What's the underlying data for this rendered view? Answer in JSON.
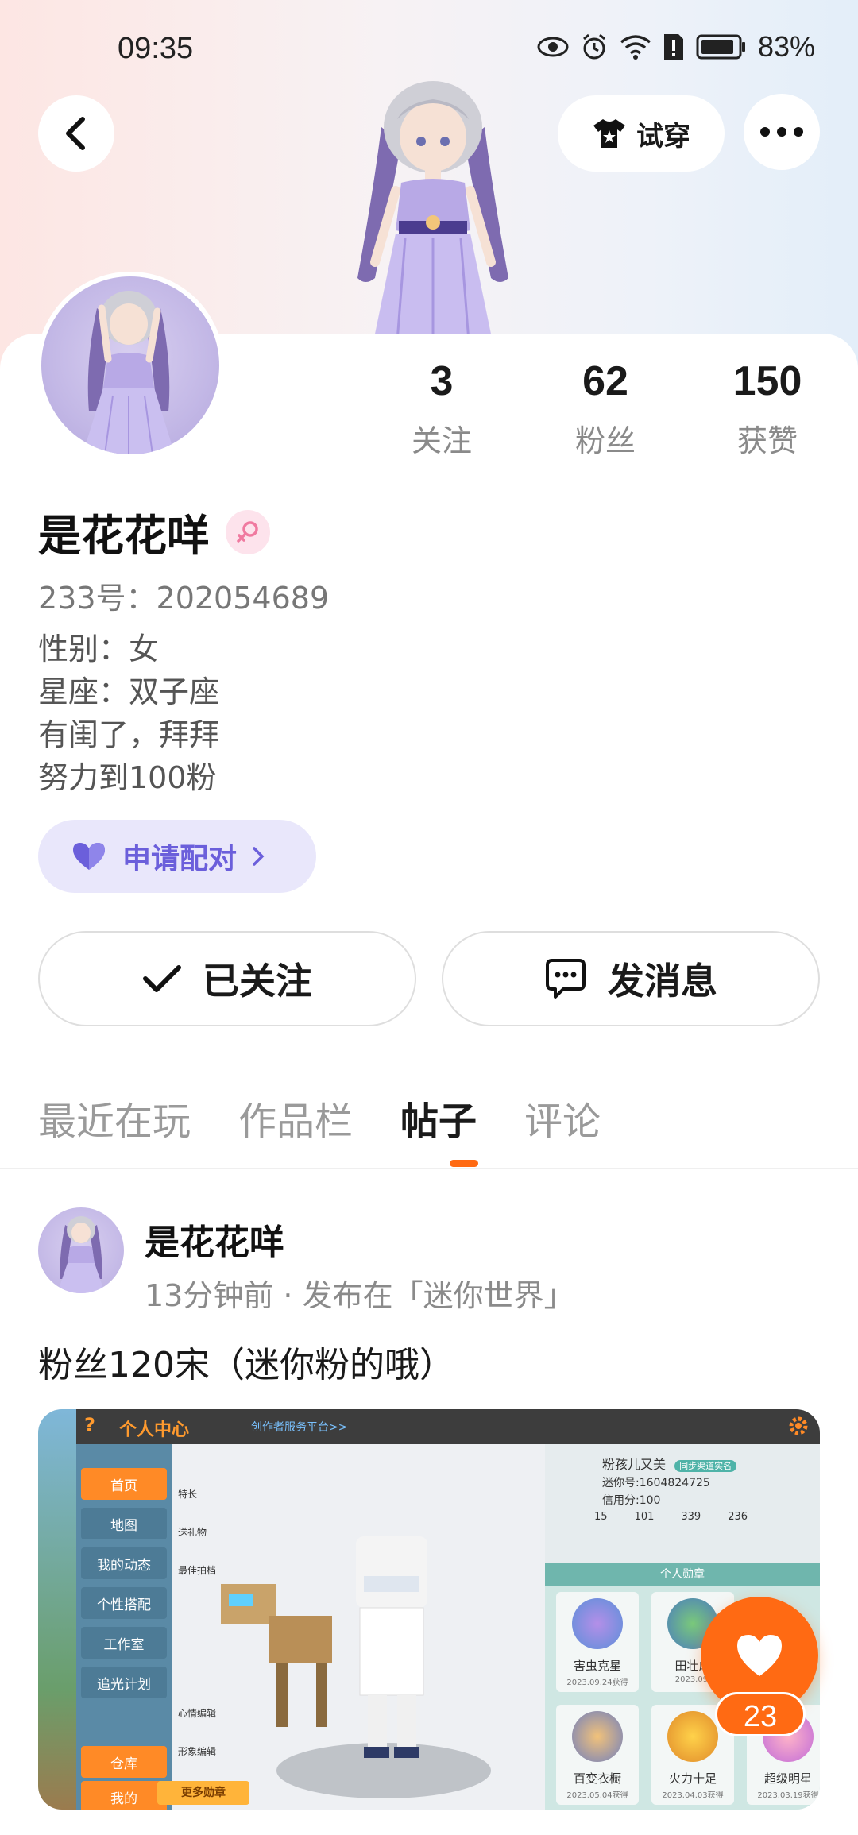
{
  "status_bar": {
    "time": "09:35",
    "battery": "83%"
  },
  "top_bar": {
    "try_on_label": "试穿"
  },
  "profile": {
    "stats": [
      {
        "value": "3",
        "label": "关注"
      },
      {
        "value": "62",
        "label": "粉丝"
      },
      {
        "value": "150",
        "label": "获赞"
      }
    ],
    "username": "是花花咩",
    "uid": "233号：202054689",
    "bio_lines": [
      "性别：女",
      "星座：双子座",
      "有闺了，拜拜",
      "努力到100粉"
    ],
    "pair_label": "申请配对",
    "followed_label": "已关注",
    "message_label": "发消息"
  },
  "tabs": [
    {
      "label": "最近在玩"
    },
    {
      "label": "作品栏"
    },
    {
      "label": "帖子",
      "active": true
    },
    {
      "label": "评论"
    }
  ],
  "post": {
    "author": "是花花咩",
    "meta": "13分钟前 · 发布在「迷你世界」",
    "text": "粉丝120宋（迷你粉的哦）",
    "image": {
      "title": "个人中心",
      "subtitle": "创作者服务平台>>",
      "menu": [
        "首页",
        "地图",
        "我的动态",
        "个性搭配",
        "工作室",
        "追光计划",
        "仓库",
        "我的"
      ],
      "side_labels": [
        "特长",
        "送礼物",
        "最佳拍档",
        "心情编辑",
        "形象编辑"
      ],
      "player_name": "粉孩儿又美",
      "player_tag": "同步渠道实名",
      "player_id": "迷你号:1604824725",
      "player_credit": "信用分:100",
      "player_stats": [
        "15",
        "101",
        "339",
        "236"
      ],
      "badges_title": "个人勋章",
      "badges": [
        {
          "name": "害虫克星",
          "date": "2023.09.24获得"
        },
        {
          "name": "田壮成",
          "date": "2023.09."
        },
        {
          "name": "百变衣橱",
          "date": "2023.05.04获得"
        },
        {
          "name": "火力十足",
          "date": "2023.04.03获得"
        },
        {
          "name": "超级明星",
          "date": "2023.03.19获得"
        }
      ],
      "more_badges": "更多勋章"
    }
  },
  "like": {
    "count": "23"
  },
  "colors": {
    "accent": "#ff6a13",
    "pair_purple": "#6b5fdb",
    "pair_bg": "#e9e7fb"
  }
}
